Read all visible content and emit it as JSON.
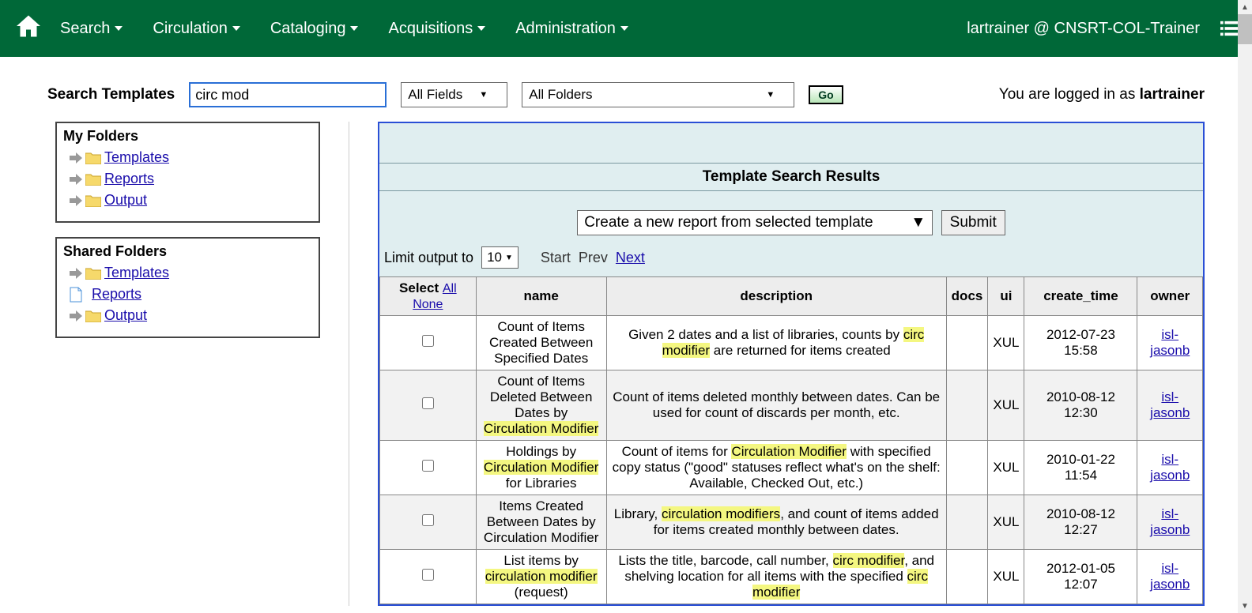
{
  "topbar": {
    "nav": [
      "Search",
      "Circulation",
      "Cataloging",
      "Acquisitions",
      "Administration"
    ],
    "user": "lartrainer @ CNSRT-COL-Trainer"
  },
  "searchbar": {
    "label": "Search Templates",
    "query": "circ mod",
    "field_filter": "All Fields",
    "folder_filter": "All Folders",
    "go": "Go",
    "logged_in_prefix": "You are logged in as ",
    "logged_in_user": "lartrainer"
  },
  "sidebar": {
    "my_folders_title": "My Folders",
    "my_folders": [
      "Templates",
      "Reports",
      "Output"
    ],
    "shared_folders_title": "Shared Folders",
    "shared_folders": [
      "Templates",
      "Reports",
      "Output"
    ]
  },
  "results": {
    "title": "Template Search Results",
    "action_select": "Create a new report from selected template",
    "submit": "Submit",
    "limit_label": "Limit output to",
    "limit_value": "10",
    "pager": {
      "start": "Start",
      "prev": "Prev",
      "next": "Next"
    },
    "columns": {
      "select": "Select",
      "all": "All",
      "none": "None",
      "name": "name",
      "description": "description",
      "docs": "docs",
      "ui": "ui",
      "create_time": "create_time",
      "owner": "owner"
    },
    "rows": [
      {
        "name_pre": "Count of Items Created Between Specified Dates",
        "name_hl": [],
        "name_html": "Count of Items Created Between Specified Dates",
        "desc_html": "Given 2 dates and a list of libraries, counts by <span class='hl'>circ modifier</span> are returned for items created",
        "docs": "",
        "ui": "XUL",
        "create_time": "2012-07-23 15:58",
        "owner": "isl-jasonb"
      },
      {
        "name_html": "Count of Items Deleted Between Dates by <span class='hl'>Circulation Modifier</span>",
        "desc_html": "Count of items deleted monthly between dates. Can be used for count of discards per month, etc.",
        "docs": "",
        "ui": "XUL",
        "create_time": "2010-08-12 12:30",
        "owner": "isl-jasonb"
      },
      {
        "name_html": "Holdings by <span class='hl'>Circulation Modifier</span> for Libraries",
        "desc_html": "Count of items for <span class='hl'>Circulation Modifier</span> with specified copy status (\"good\" statuses reflect what's on the shelf: Available, Checked Out, etc.)",
        "docs": "",
        "ui": "XUL",
        "create_time": "2010-01-22 11:54",
        "owner": "isl-jasonb"
      },
      {
        "name_html": "Items Created Between Dates by Circulation Modifier",
        "desc_html": "Library, <span class='hl'>circulation modifiers</span>, and count of items added for items created monthly between dates.",
        "docs": "",
        "ui": "XUL",
        "create_time": "2010-08-12 12:27",
        "owner": "isl-jasonb"
      },
      {
        "name_html": "List items by <span class='hl'>circulation modifier</span> (request)",
        "desc_html": "Lists the title, barcode, call number, <span class='hl'>circ modifier</span>, and shelving location for all items with the specified <span class='hl'>circ modifier</span>",
        "docs": "",
        "ui": "XUL",
        "create_time": "2012-01-05 12:07",
        "owner": "isl-jasonb"
      }
    ]
  }
}
